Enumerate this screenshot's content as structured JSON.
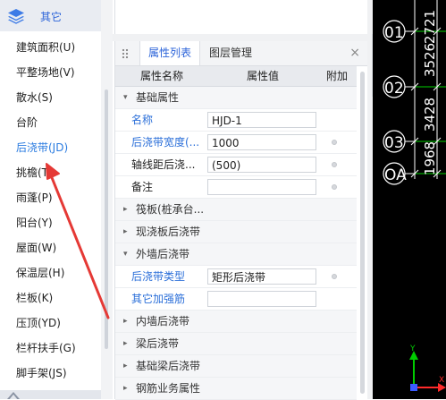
{
  "sidebar": {
    "header": "其它",
    "items": [
      {
        "label": "建筑面积(U)",
        "active": false
      },
      {
        "label": "平整场地(V)",
        "active": false
      },
      {
        "label": "散水(S)",
        "active": false
      },
      {
        "label": "台阶",
        "active": false
      },
      {
        "label": "后浇带(JD)",
        "active": true
      },
      {
        "label": "挑檐(T)",
        "active": false
      },
      {
        "label": "雨蓬(P)",
        "active": false
      },
      {
        "label": "阳台(Y)",
        "active": false
      },
      {
        "label": "屋面(W)",
        "active": false
      },
      {
        "label": "保温层(H)",
        "active": false
      },
      {
        "label": "栏板(K)",
        "active": false
      },
      {
        "label": "压顶(YD)",
        "active": false
      },
      {
        "label": "栏杆扶手(G)",
        "active": false
      },
      {
        "label": "脚手架(JS)",
        "active": false
      }
    ]
  },
  "panel": {
    "tabs": [
      {
        "label": "属性列表",
        "active": true
      },
      {
        "label": "图层管理",
        "active": false
      }
    ],
    "close": "×",
    "columns": {
      "name": "属性名称",
      "value": "属性值",
      "extra": "附加"
    },
    "rows": [
      {
        "type": "group",
        "caret": "▾",
        "label": "基础属性"
      },
      {
        "type": "prop",
        "label": "名称",
        "value": "HJD-1",
        "blue": true,
        "dot": false
      },
      {
        "type": "prop",
        "label": "后浇带宽度(...",
        "value": "1000",
        "blue": true,
        "dot": true
      },
      {
        "type": "prop",
        "label": "轴线距后浇...",
        "value": "(500)",
        "blue": false,
        "dot": true
      },
      {
        "type": "prop",
        "label": "备注",
        "value": "",
        "blue": false,
        "dot": true
      },
      {
        "type": "group",
        "caret": "▸",
        "label": "筏板(桩承台..."
      },
      {
        "type": "group",
        "caret": "▸",
        "label": "现浇板后浇带"
      },
      {
        "type": "group",
        "caret": "▾",
        "label": "外墙后浇带"
      },
      {
        "type": "prop",
        "label": "后浇带类型",
        "value": "矩形后浇带",
        "blue": true,
        "dot": true
      },
      {
        "type": "prop",
        "label": "其它加强筋",
        "value": "",
        "blue": true,
        "dot": false
      },
      {
        "type": "group",
        "caret": "▸",
        "label": "内墙后浇带"
      },
      {
        "type": "group",
        "caret": "▸",
        "label": "梁后浇带"
      },
      {
        "type": "group",
        "caret": "▸",
        "label": "基础梁后浇带"
      },
      {
        "type": "group",
        "caret": "▸",
        "label": "钢筋业务属性"
      }
    ]
  },
  "cad": {
    "axes": [
      "01",
      "02",
      "03",
      "OA"
    ],
    "dimensions": [
      "2721",
      "3526",
      "3428",
      "1968"
    ],
    "ucs": {
      "y": "Y",
      "x": "X"
    },
    "colors": {
      "axis_line": "#00d000",
      "text": "#ffffff",
      "ucs_y": "#00cc00",
      "ucs_x": "#ff2a2a",
      "ucs_origin": "#3b5bff"
    }
  },
  "colors": {
    "accent": "#2b63d9",
    "active_item": "#2b7ce0",
    "annotation_arrow": "#e53935"
  }
}
